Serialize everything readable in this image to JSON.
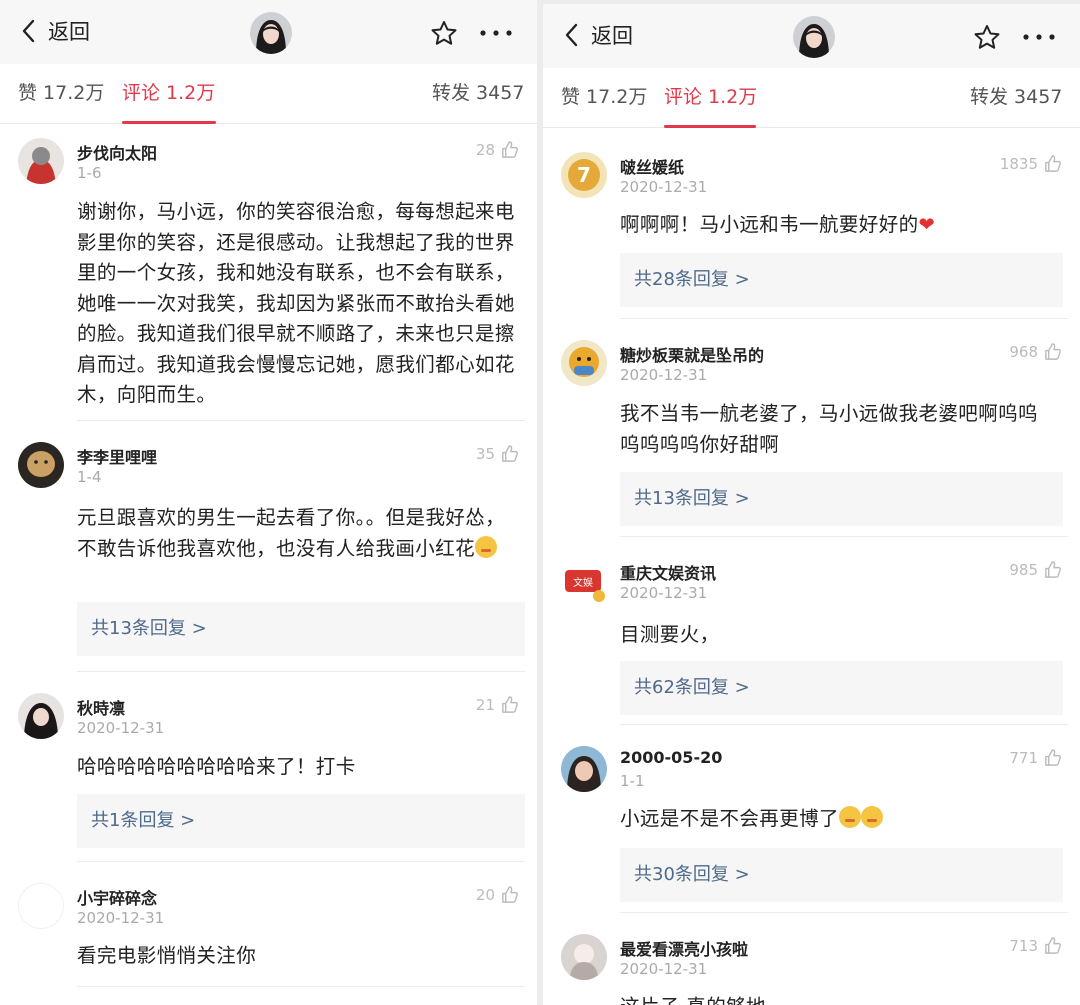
{
  "panels": [
    {
      "header": {
        "back_label": "返回"
      },
      "tabs": {
        "likes": "赞 17.2万",
        "comments": "评论 1.2万",
        "reposts": "转发 3457"
      },
      "comments": [
        {
          "name": "步伐向太阳",
          "date": "1-6",
          "likes": "28",
          "text": "谢谢你，马小远，你的笑容很治愈，每每想起来电影里你的笑容，还是很感动。让我想起了我的世界里的一个女孩，我和她没有联系，也不会有联系，她唯一一次对我笑，我却因为紧张而不敢抬头看她的脸。我知道我们很早就不顺路了，未来也只是擦肩而过。我知道我会慢慢忘记她，愿我们都心如花木，向阳而生。",
          "replies": ""
        },
        {
          "name": "李李里哩哩",
          "date": "1-4",
          "likes": "35",
          "text": "元旦跟喜欢的男生一起去看了你。。但是我好怂，不敢告诉他我喜欢他，也没有人给我画小红花",
          "replies": "共13条回复 >"
        },
        {
          "name": "秋時凛",
          "date": "2020-12-31",
          "likes": "21",
          "text": "哈哈哈哈哈哈哈哈哈来了！打卡",
          "replies": "共1条回复 >"
        },
        {
          "name": "小宇碎碎念",
          "date": "2020-12-31",
          "likes": "20",
          "text": "看完电影悄悄关注你",
          "replies": ""
        }
      ]
    },
    {
      "header": {
        "back_label": "返回"
      },
      "tabs": {
        "likes": "赞 17.2万",
        "comments": "评论 1.2万",
        "reposts": "转发 3457"
      },
      "comments": [
        {
          "name": "啵丝媛纸",
          "date": "2020-12-31",
          "likes": "1835",
          "text": "啊啊啊！马小远和韦一航要好好的",
          "replies": "共28条回复 >"
        },
        {
          "name": "糖炒板栗就是坠吊的",
          "date": "2020-12-31",
          "likes": "968",
          "text": "我不当韦一航老婆了，马小远做我老婆吧啊呜呜呜呜呜呜你好甜啊",
          "replies": "共13条回复 >"
        },
        {
          "name": "重庆文娱资讯",
          "date": "2020-12-31",
          "likes": "985",
          "text": "目测要火，",
          "replies": "共62条回复 >"
        },
        {
          "name": "2000-05-20",
          "date": "1-1",
          "likes": "771",
          "text": "小远是不是不会再更博了",
          "replies": "共30条回复 >"
        },
        {
          "name": "最爱看漂亮小孩啦",
          "date": "2020-12-31",
          "likes": "713",
          "text": "这片子 真的够地",
          "replies": ""
        }
      ]
    }
  ],
  "colors": {
    "accent": "#e2384a",
    "reply_link": "#4f6a8a"
  },
  "icons": [
    "back-chevron-icon",
    "star-icon",
    "more-icon",
    "thumb-up-icon",
    "heart-emoji",
    "shy-emoji"
  ]
}
